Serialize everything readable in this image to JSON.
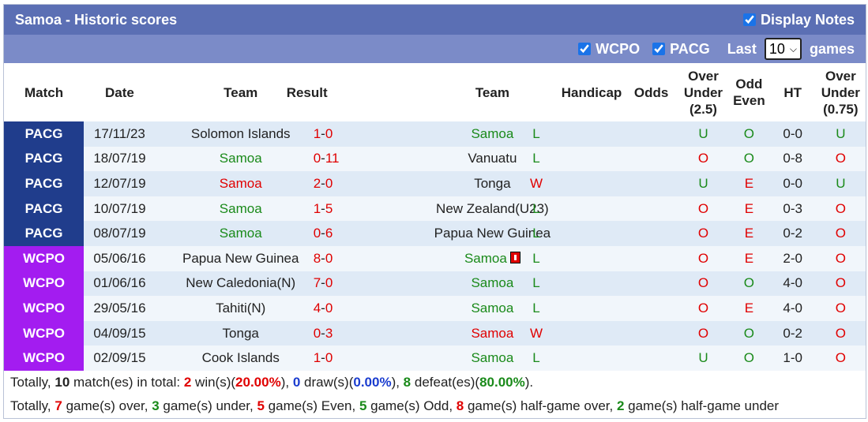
{
  "header": {
    "title": "Samoa - Historic scores",
    "display_notes": "Display Notes"
  },
  "filters": {
    "wcpo": "WCPO",
    "pacg": "PACG",
    "last": "Last",
    "last_value": "10",
    "games": "games"
  },
  "columns": {
    "match": "Match",
    "date": "Date",
    "team1": "Team",
    "result": "Result",
    "team2": "Team",
    "handicap": "Handicap",
    "odds": "Odds",
    "ou_a": "Over",
    "ou_b": "Under",
    "ou_c": "(2.5)",
    "oe_a": "Odd",
    "oe_b": "Even",
    "ht": "HT",
    "ou2_a": "Over",
    "ou2_b": "Under",
    "ou2_c": "(0.75)"
  },
  "rows": [
    {
      "league": "PACG",
      "date": "17/11/23",
      "home": "Solomon Islands",
      "home_c": "",
      "hs": "1",
      "as": "0",
      "away": "Samoa",
      "away_c": "green",
      "res": "L",
      "res_c": "green",
      "ou": "U",
      "ou_c": "green",
      "oe": "O",
      "oe_c": "green",
      "ht": "0-0",
      "ou2": "U",
      "ou2_c": "green",
      "card": false
    },
    {
      "league": "PACG",
      "date": "18/07/19",
      "home": "Samoa",
      "home_c": "green",
      "hs": "0",
      "as": "11",
      "away": "Vanuatu",
      "away_c": "",
      "res": "L",
      "res_c": "green",
      "ou": "O",
      "ou_c": "red",
      "oe": "O",
      "oe_c": "green",
      "ht": "0-8",
      "ou2": "O",
      "ou2_c": "red",
      "card": false
    },
    {
      "league": "PACG",
      "date": "12/07/19",
      "home": "Samoa",
      "home_c": "red",
      "hs": "2",
      "as": "0",
      "away": "Tonga",
      "away_c": "",
      "res": "W",
      "res_c": "red",
      "ou": "U",
      "ou_c": "green",
      "oe": "E",
      "oe_c": "red",
      "ht": "0-0",
      "ou2": "U",
      "ou2_c": "green",
      "card": false
    },
    {
      "league": "PACG",
      "date": "10/07/19",
      "home": "Samoa",
      "home_c": "green",
      "hs": "1",
      "as": "5",
      "away": "New Zealand(U23)",
      "away_c": "",
      "res": "L",
      "res_c": "green",
      "ou": "O",
      "ou_c": "red",
      "oe": "E",
      "oe_c": "red",
      "ht": "0-3",
      "ou2": "O",
      "ou2_c": "red",
      "card": false
    },
    {
      "league": "PACG",
      "date": "08/07/19",
      "home": "Samoa",
      "home_c": "green",
      "hs": "0",
      "as": "6",
      "away": "Papua New Guinea",
      "away_c": "",
      "res": "L",
      "res_c": "green",
      "ou": "O",
      "ou_c": "red",
      "oe": "E",
      "oe_c": "red",
      "ht": "0-2",
      "ou2": "O",
      "ou2_c": "red",
      "card": false
    },
    {
      "league": "WCPO",
      "date": "05/06/16",
      "home": "Papua New Guinea",
      "home_c": "",
      "hs": "8",
      "as": "0",
      "away": "Samoa",
      "away_c": "green",
      "res": "L",
      "res_c": "green",
      "ou": "O",
      "ou_c": "red",
      "oe": "E",
      "oe_c": "red",
      "ht": "2-0",
      "ou2": "O",
      "ou2_c": "red",
      "card": true
    },
    {
      "league": "WCPO",
      "date": "01/06/16",
      "home": "New Caledonia(N)",
      "home_c": "",
      "hs": "7",
      "as": "0",
      "away": "Samoa",
      "away_c": "green",
      "res": "L",
      "res_c": "green",
      "ou": "O",
      "ou_c": "red",
      "oe": "O",
      "oe_c": "green",
      "ht": "4-0",
      "ou2": "O",
      "ou2_c": "red",
      "card": false
    },
    {
      "league": "WCPO",
      "date": "29/05/16",
      "home": "Tahiti(N)",
      "home_c": "",
      "hs": "4",
      "as": "0",
      "away": "Samoa",
      "away_c": "green",
      "res": "L",
      "res_c": "green",
      "ou": "O",
      "ou_c": "red",
      "oe": "E",
      "oe_c": "red",
      "ht": "4-0",
      "ou2": "O",
      "ou2_c": "red",
      "card": false
    },
    {
      "league": "WCPO",
      "date": "04/09/15",
      "home": "Tonga",
      "home_c": "",
      "hs": "0",
      "as": "3",
      "away": "Samoa",
      "away_c": "red",
      "res": "W",
      "res_c": "red",
      "ou": "O",
      "ou_c": "red",
      "oe": "O",
      "oe_c": "green",
      "ht": "0-2",
      "ou2": "O",
      "ou2_c": "red",
      "card": false
    },
    {
      "league": "WCPO",
      "date": "02/09/15",
      "home": "Cook Islands",
      "home_c": "",
      "hs": "1",
      "as": "0",
      "away": "Samoa",
      "away_c": "green",
      "res": "L",
      "res_c": "green",
      "ou": "U",
      "ou_c": "green",
      "oe": "O",
      "oe_c": "green",
      "ht": "1-0",
      "ou2": "O",
      "ou2_c": "red",
      "card": false
    }
  ],
  "summary1": [
    {
      "t": "Totally, ",
      "c": ""
    },
    {
      "t": "10",
      "c": "b"
    },
    {
      "t": " match(es) in total: ",
      "c": ""
    },
    {
      "t": "2",
      "c": "red"
    },
    {
      "t": " win(s)(",
      "c": ""
    },
    {
      "t": "20.00%",
      "c": "red"
    },
    {
      "t": "), ",
      "c": ""
    },
    {
      "t": "0",
      "c": "blue"
    },
    {
      "t": " draw(s)(",
      "c": ""
    },
    {
      "t": "0.00%",
      "c": "blue"
    },
    {
      "t": "), ",
      "c": ""
    },
    {
      "t": "8",
      "c": "green"
    },
    {
      "t": " defeat(es)(",
      "c": ""
    },
    {
      "t": "80.00%",
      "c": "green"
    },
    {
      "t": ").",
      "c": ""
    }
  ],
  "summary2": [
    {
      "t": "Totally, ",
      "c": ""
    },
    {
      "t": "7",
      "c": "red"
    },
    {
      "t": " game(s) over, ",
      "c": ""
    },
    {
      "t": "3",
      "c": "green"
    },
    {
      "t": " game(s) under, ",
      "c": ""
    },
    {
      "t": "5",
      "c": "red"
    },
    {
      "t": " game(s) Even, ",
      "c": ""
    },
    {
      "t": "5",
      "c": "green"
    },
    {
      "t": " game(s) Odd, ",
      "c": ""
    },
    {
      "t": "8",
      "c": "red"
    },
    {
      "t": " game(s) half-game over, ",
      "c": ""
    },
    {
      "t": "2",
      "c": "green"
    },
    {
      "t": " game(s) half-game under",
      "c": ""
    }
  ],
  "colors": {
    "title_bg": "#5b6fb4",
    "filter_bg": "#7b8bc8",
    "pacg": "#203d8c",
    "wcpo": "#a31cf0",
    "win": "#e00000",
    "loss": "#1a8a1a",
    "draw": "#1a3ccf"
  }
}
